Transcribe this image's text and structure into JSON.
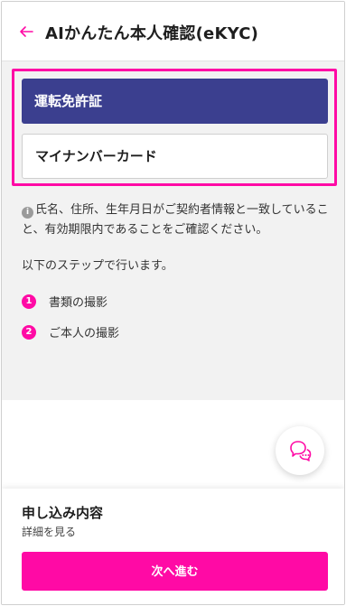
{
  "header": {
    "title": "AIかんたん本人確認(eKYC)",
    "back_icon": "back-arrow-icon"
  },
  "document_options": [
    {
      "label": "運転免許証",
      "selected": true
    },
    {
      "label": "マイナンバーカード",
      "selected": false
    }
  ],
  "notice": {
    "icon": "info-icon",
    "icon_glyph": "i",
    "text": "氏名、住所、生年月日がご契約者情報と一致していること、有効期限内であることをご確認ください。"
  },
  "steps": {
    "intro": "以下のステップで行います。",
    "items": [
      {
        "number": "1",
        "label": "書類の撮影"
      },
      {
        "number": "2",
        "label": "ご本人の撮影"
      }
    ]
  },
  "chat": {
    "icon": "chat-support-icon"
  },
  "footer": {
    "summary_title": "申し込み内容",
    "summary_link": "詳細を見る",
    "next_button": "次へ進む"
  },
  "colors": {
    "accent": "#ff0aa5",
    "selected_option": "#3b3f8f",
    "content_bg": "#f2f2f2"
  }
}
